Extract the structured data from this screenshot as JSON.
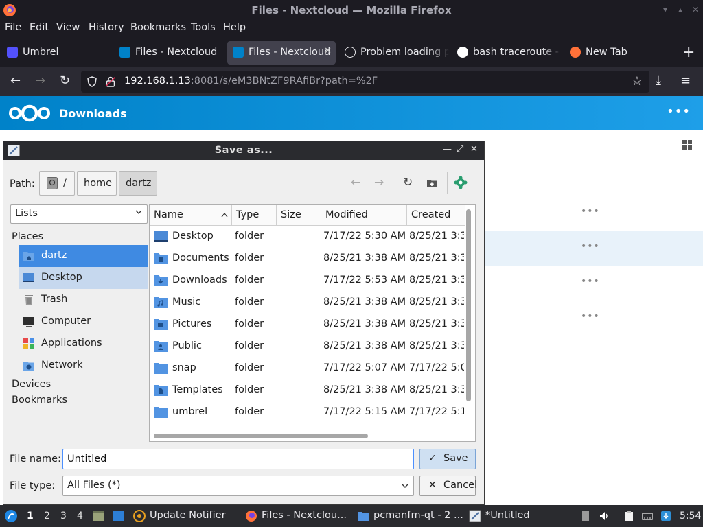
{
  "window": {
    "title": "Files - Nextcloud — Mozilla Firefox"
  },
  "menu": [
    "File",
    "Edit",
    "View",
    "History",
    "Bookmarks",
    "Tools",
    "Help"
  ],
  "tabs": [
    {
      "label": "Umbrel"
    },
    {
      "label": "Files - Nextcloud"
    },
    {
      "label": "Files - Nextcloud"
    },
    {
      "label": "Problem loading p"
    },
    {
      "label": "bash traceroute -"
    },
    {
      "label": "New Tab"
    }
  ],
  "urlbar": {
    "host": "192.168.1.13",
    "rest": ":8081/s/eM3BNtZF9RAfiBr?path=%2F"
  },
  "nextcloud": {
    "folder_name": "Downloads",
    "row_dots": "•••"
  },
  "dialog": {
    "title": "Save as...",
    "path_label": "Path:",
    "path_segments": [
      "/",
      "home",
      "dartz"
    ],
    "view_mode": "Lists",
    "places_header": "Places",
    "places": [
      {
        "label": "dartz",
        "icon": "home-folder-icon"
      },
      {
        "label": "Desktop",
        "icon": "desktop-icon"
      },
      {
        "label": "Trash",
        "icon": "trash-icon"
      },
      {
        "label": "Computer",
        "icon": "computer-icon"
      },
      {
        "label": "Applications",
        "icon": "applications-icon"
      },
      {
        "label": "Network",
        "icon": "network-icon"
      }
    ],
    "devices_header": "Devices",
    "bookmarks_header": "Bookmarks",
    "columns": [
      "Name",
      "Type",
      "Size",
      "Modified",
      "Created"
    ],
    "files": [
      {
        "name": "Desktop",
        "type": "folder",
        "modified": "7/17/22 5:30 AM",
        "created": "8/25/21 3:3"
      },
      {
        "name": "Documents",
        "type": "folder",
        "modified": "8/25/21 3:38 AM",
        "created": "8/25/21 3:3"
      },
      {
        "name": "Downloads",
        "type": "folder",
        "modified": "7/17/22 5:53 AM",
        "created": "8/25/21 3:3"
      },
      {
        "name": "Music",
        "type": "folder",
        "modified": "8/25/21 3:38 AM",
        "created": "8/25/21 3:3"
      },
      {
        "name": "Pictures",
        "type": "folder",
        "modified": "8/25/21 3:38 AM",
        "created": "8/25/21 3:3"
      },
      {
        "name": "Public",
        "type": "folder",
        "modified": "8/25/21 3:38 AM",
        "created": "8/25/21 3:3"
      },
      {
        "name": "snap",
        "type": "folder",
        "modified": "7/17/22 5:07 AM",
        "created": "7/17/22 5:0"
      },
      {
        "name": "Templates",
        "type": "folder",
        "modified": "8/25/21 3:38 AM",
        "created": "8/25/21 3:3"
      },
      {
        "name": "umbrel",
        "type": "folder",
        "modified": "7/17/22 5:15 AM",
        "created": "7/17/22 5:1"
      }
    ],
    "file_name_label": "File name:",
    "file_name_value": "Untitled",
    "file_type_label": "File type:",
    "file_type_value": "All Files (*)",
    "save_label": "Save",
    "cancel_label": "Cancel"
  },
  "taskbar": {
    "workspaces": [
      "1",
      "2",
      "3",
      "4"
    ],
    "tasks": [
      {
        "label": "Update Notifier"
      },
      {
        "label": "Files - Nextclou..."
      },
      {
        "label": "pcmanfm-qt - 2 ..."
      },
      {
        "label": "*Untitled"
      }
    ],
    "clock": "5:54"
  },
  "colors": {
    "nextcloud_blue": "#0082c9",
    "selection": "#3f8ae2",
    "folder": "#5294e2"
  }
}
